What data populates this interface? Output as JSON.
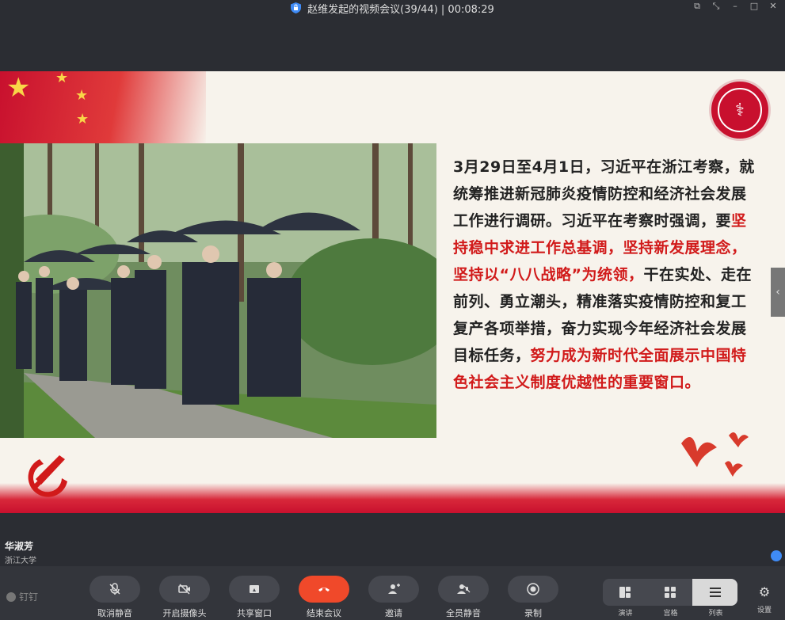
{
  "titlebar": {
    "title": "赵维发起的视频会议(39/44) | 00:08:29",
    "icons": [
      "shield-icon",
      "window-float-icon",
      "shrink-icon",
      "minimize-icon",
      "maximize-icon",
      "close-icon"
    ]
  },
  "slide": {
    "paragraph": [
      {
        "text": "3月29日至4月1日，习近平在浙江考察，就统筹推进新冠肺炎疫情防控和经济社会发展工作进行调研。习近平在考察时强调，要",
        "red": false
      },
      {
        "text": "坚持稳中求进工作总基调，坚持新发展理念，坚持以“八八战略”为统领，",
        "red": true
      },
      {
        "text": "干在实处、走在前列、勇立潮头，精准落实疫情防控和复工复产各项举措，奋力实现今年经济社会发展目标任务，",
        "red": false
      },
      {
        "text": "努力成为新时代全面展示中国特色社会主义制度优越性的重要窗口。",
        "red": true
      }
    ],
    "accent_red": "#d11a1a"
  },
  "participant": {
    "name": "华淑芳",
    "org": "浙江大学"
  },
  "toolbar": {
    "dingding_label": "钉钉",
    "buttons": [
      {
        "label": "取消静音",
        "icon": "mic-off-icon"
      },
      {
        "label": "开启摄像头",
        "icon": "camera-off-icon"
      },
      {
        "label": "共享窗口",
        "icon": "share-window-icon"
      },
      {
        "label": "结束会议",
        "icon": "end-call-icon"
      },
      {
        "label": "邀请",
        "icon": "invite-icon"
      },
      {
        "label": "全员静音",
        "icon": "mute-all-icon"
      },
      {
        "label": "录制",
        "icon": "record-icon"
      }
    ],
    "layouts": [
      {
        "label": "演讲",
        "icon": "speaker-layout-icon"
      },
      {
        "label": "宫格",
        "icon": "grid-layout-icon"
      },
      {
        "label": "列表",
        "icon": "list-layout-icon"
      }
    ],
    "settings_label": "设置",
    "end_color": "#f0492a"
  }
}
